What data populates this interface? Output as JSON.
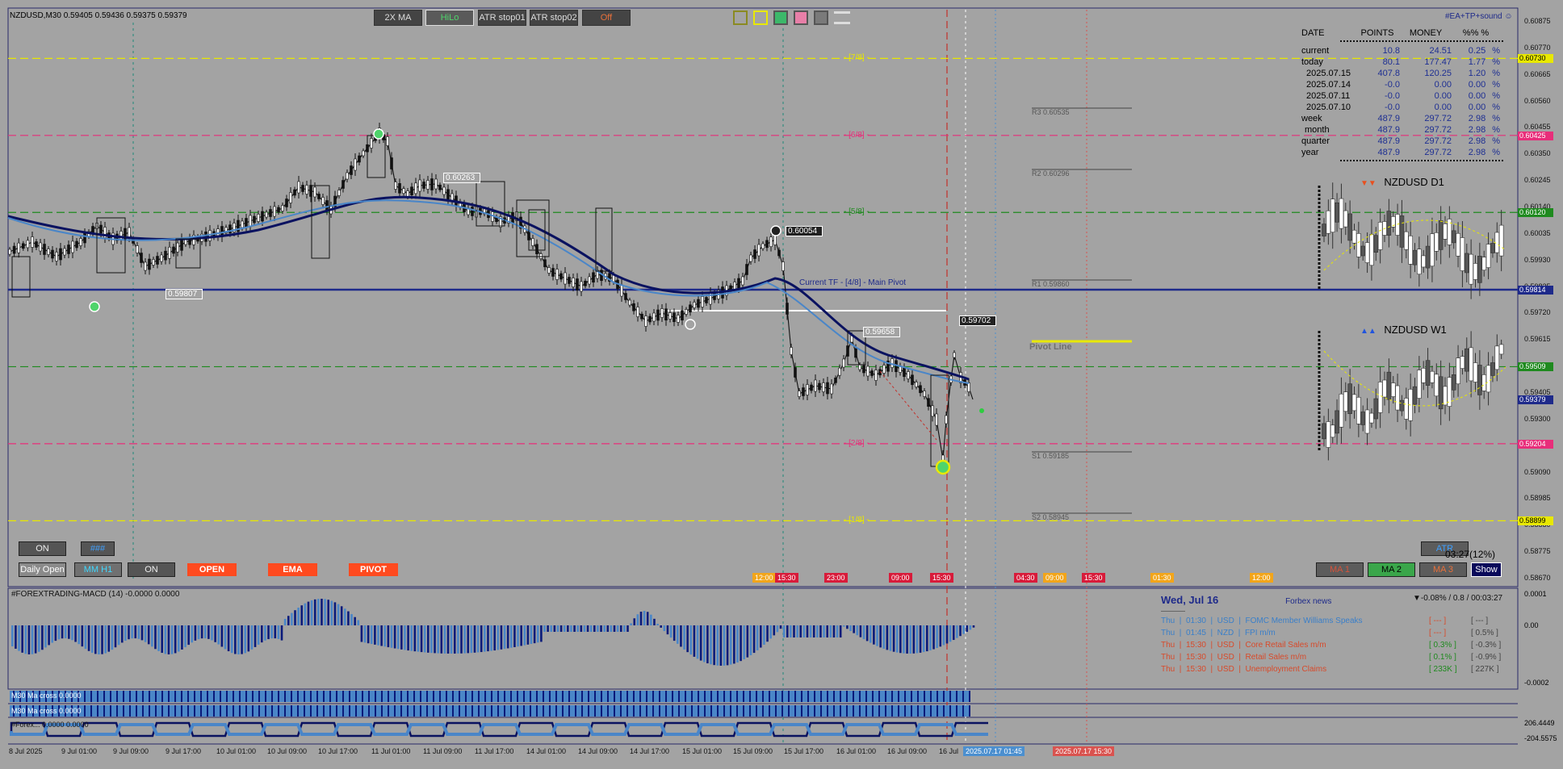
{
  "window": {
    "title": "NZDUSD,M30",
    "ohlc": "0.59405 0.59436 0.59375 0.59379",
    "ea_label": "#EA+TP+sound",
    "smiley_icon": "smiley-icon"
  },
  "toolbar": {
    "buttons": [
      "2X MA",
      "HiLo",
      "ATR stop01",
      "ATR stop02",
      "Off"
    ]
  },
  "swatches": [
    "#a3a3a3",
    "#a3a3a3",
    "#3cb86a",
    "#e87fa8",
    "#7a7a7a"
  ],
  "murray_levels": [
    {
      "label": "- [7/8] -",
      "price": 0.6073,
      "tag": "0.60730",
      "color": "#e8e800"
    },
    {
      "label": "- [6/8] -",
      "price": 0.60425,
      "tag": "0.60425",
      "color": "#e82e7a"
    },
    {
      "label": "- [5/8] -",
      "price": 0.6012,
      "tag": "0.60120",
      "color": "#1f8a1f"
    },
    {
      "label": "Current TF - [4/8] - Main Pivot",
      "price": 0.59814,
      "tag": "0.59814",
      "color": "#1e2a8a"
    },
    {
      "label": "",
      "price": 0.59509,
      "tag": "0.59509",
      "color": "#1f8a1f"
    },
    {
      "label": "- [2/8] -",
      "price": 0.59204,
      "tag": "0.59204",
      "color": "#e82e7a"
    },
    {
      "label": "- [1/8] -",
      "price": 0.58899,
      "tag": "0.58899",
      "color": "#e8e800"
    }
  ],
  "pivots": [
    {
      "label": "R3 0.60535"
    },
    {
      "label": "R2 0.60296"
    },
    {
      "label": "R1 0.59860"
    },
    {
      "label": "Pivot Line"
    },
    {
      "label": "S1 0.59185"
    },
    {
      "label": "S2 0.58945"
    }
  ],
  "price_markers": [
    "0.60263",
    "0.59807",
    "0.60054",
    "0.59658",
    "0.59702"
  ],
  "price_axis": [
    "0.60875",
    "0.60770",
    "0.60665",
    "0.60560",
    "0.60455",
    "0.60350",
    "0.60245",
    "0.60140",
    "0.60035",
    "0.59930",
    "0.59825",
    "0.59720",
    "0.59615",
    "0.59510",
    "0.59405",
    "0.59300",
    "0.59195",
    "0.59090",
    "0.58985",
    "0.58880",
    "0.58775",
    "0.58670"
  ],
  "current_price_tag": "0.59379",
  "stats": {
    "headers": [
      "DATE",
      "POINTS",
      "MONEY",
      "%%",
      "%"
    ],
    "rows": [
      {
        "date": "current",
        "points": "10.8",
        "money": "24.51",
        "pct": "0.25",
        "sym": "%"
      },
      {
        "date": "today",
        "points": "80.1",
        "money": "177.47",
        "pct": "1.77",
        "sym": "%"
      },
      {
        "date": "2025.07.15",
        "points": "407.8",
        "money": "120.25",
        "pct": "1.20",
        "sym": "%"
      },
      {
        "date": "2025.07.14",
        "points": "-0.0",
        "money": "0.00",
        "pct": "0.00",
        "sym": "%"
      },
      {
        "date": "2025.07.11",
        "points": "-0.0",
        "money": "0.00",
        "pct": "0.00",
        "sym": "%"
      },
      {
        "date": "2025.07.10",
        "points": "-0.0",
        "money": "0.00",
        "pct": "0.00",
        "sym": "%"
      },
      {
        "date": "week",
        "points": "487.9",
        "money": "297.72",
        "pct": "2.98",
        "sym": "%"
      },
      {
        "date": "month",
        "points": "487.9",
        "money": "297.72",
        "pct": "2.98",
        "sym": "%"
      },
      {
        "date": "quarter",
        "points": "487.9",
        "money": "297.72",
        "pct": "2.98",
        "sym": "%"
      },
      {
        "date": "year",
        "points": "487.9",
        "money": "297.72",
        "pct": "2.98",
        "sym": "%"
      }
    ]
  },
  "mini_charts": [
    {
      "title": "NZDUSD  D1",
      "arrows": "▼▼",
      "arrow_color": "#e8501f"
    },
    {
      "title": "NZDUSD  W1",
      "arrows": "▲▲",
      "arrow_color": "#2255dd"
    }
  ],
  "left_buttons": {
    "on1": "ON",
    "hash": "###",
    "daily_open": "Daily Open",
    "mm_h1": "MM H1",
    "on2": "ON",
    "open": "OPEN",
    "ema": "EMA",
    "pivot": "PIVOT"
  },
  "right_buttons": {
    "atr": "ATR",
    "timer": "03:27(12%)",
    "ma1": "MA 1",
    "ma2": "MA 2",
    "ma3": "MA 3",
    "show": "Show"
  },
  "session_tabs": [
    {
      "label": "12:00",
      "color": "#f2a51a"
    },
    {
      "label": "15:30",
      "color": "#d81b3a"
    },
    {
      "label": "23:00",
      "color": "#d81b3a"
    },
    {
      "label": "09:00",
      "color": "#d81b3a"
    },
    {
      "label": "15:30",
      "color": "#d81b3a"
    },
    {
      "label": "04:30",
      "color": "#d81b3a"
    },
    {
      "label": "09:00",
      "color": "#f2a51a"
    },
    {
      "label": "15:30",
      "color": "#d81b3a"
    },
    {
      "label": "01:30",
      "color": "#f2a51a"
    },
    {
      "label": "12:00",
      "color": "#f2a51a"
    }
  ],
  "macd": {
    "title": "#FOREXTRADING-MACD (14) -0.0000 0.0000",
    "axis_top": "0.0001",
    "axis_mid": "0.00",
    "axis_bottom": "-0.0002"
  },
  "news": {
    "date": "Wed, Jul 16",
    "source": "Forbex news",
    "status": "▼-0.08% / 0.8 / 00:03:27",
    "items": [
      {
        "text": "Thu  |  01:30  |  USD  |  FOMC Member Williams Speaks",
        "f": "[ --- ]",
        "p": "[ --- ]",
        "color": "#3a7fc9"
      },
      {
        "text": "Thu  |  01:45  |  NZD  |  FPI m/m",
        "f": "[ --- ]",
        "p": "[ 0.5% ]",
        "color": "#3a7fc9"
      },
      {
        "text": "Thu  |  15:30  |  USD  |  Core Retail Sales m/m",
        "f": "[ 0.3% ]",
        "p": "[ -0.3% ]",
        "color": "#d84a2a"
      },
      {
        "text": "Thu  |  15:30  |  USD  |  Retail Sales m/m",
        "f": "[ 0.1% ]",
        "p": "[ -0.9% ]",
        "color": "#d84a2a"
      },
      {
        "text": "Thu  |  15:30  |  USD  |  Unemployment Claims",
        "f": "[ 233K ]",
        "p": "[ 227K ]",
        "color": "#d84a2a"
      }
    ]
  },
  "ma_cross": [
    "M30 Ma cross 0.0000",
    "M30 Ma cross 0.0000"
  ],
  "bottom_ind": {
    "title": "#Forex... 0.0000 0.0000",
    "axis_top": "206.4449",
    "axis_bottom": "-204.5575"
  },
  "time_axis": [
    "8 Jul 2025",
    "9 Jul 01:00",
    "9 Jul 09:00",
    "9 Jul 17:00",
    "10 Jul 01:00",
    "10 Jul 09:00",
    "10 Jul 17:00",
    "11 Jul 01:00",
    "11 Jul 09:00",
    "11 Jul 17:00",
    "14 Jul 01:00",
    "14 Jul 09:00",
    "14 Jul 17:00",
    "15 Jul 01:00",
    "15 Jul 09:00",
    "15 Jul 17:00",
    "16 Jul 01:00",
    "16 Jul 09:00",
    "16 Jul"
  ],
  "time_tags": [
    {
      "label": "2025.07.17 01:45",
      "color": "#4b8fcf"
    },
    {
      "label": "2025.07.17 15:30",
      "color": "#d9534f"
    }
  ]
}
